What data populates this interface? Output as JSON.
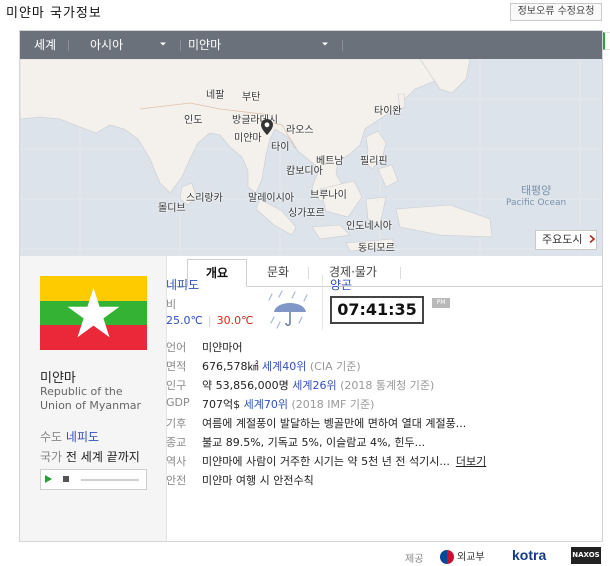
{
  "page": {
    "title": "미얀마 국가정보",
    "report_button": "정보오류 수정요청"
  },
  "nav": {
    "world": "세계",
    "region": "아시아",
    "country": "미얀마"
  },
  "map": {
    "cities": {
      "nepal": "네팔",
      "bhutan": "부탄",
      "india": "인도",
      "bangladesh": "방글라데시",
      "myanmar": "미얀마",
      "laos": "라오스",
      "thailand": "타이",
      "vietnam": "베트남",
      "cambodia": "캄보디아",
      "philippines": "필리핀",
      "taiwan": "타이완",
      "srilanka": "스리랑카",
      "maldives": "몰디브",
      "malaysia": "말레이시아",
      "brunei": "브루나이",
      "singapore": "싱가포르",
      "indonesia": "인도네시아",
      "timor": "동티모르"
    },
    "ocean_ko": "태평양",
    "ocean_en": "Pacific Ocean",
    "major_cities_button": "주요도시"
  },
  "profile": {
    "name_ko": "미얀마",
    "name_en": "Republic of the Union of Myanmar",
    "capital_label": "수도",
    "capital": "네피도",
    "anthem_label": "국가",
    "anthem": "전 세계 끝까지"
  },
  "tabs": [
    {
      "label": "개요",
      "active": true
    },
    {
      "label": "문화",
      "active": false
    },
    {
      "label": "경제·물가",
      "active": false
    }
  ],
  "capital_weather": {
    "city": "네피도",
    "condition": "비",
    "low": "25.0℃",
    "high": "30.0℃"
  },
  "city_clock": {
    "city": "양곤",
    "time": "07:41:35",
    "ampm": "PM"
  },
  "info": {
    "language": {
      "label": "언어",
      "value": "미얀마어"
    },
    "area": {
      "label": "면적",
      "value": "676,578㎢",
      "rank": "세계40위",
      "source": "(CIA 기준)"
    },
    "population": {
      "label": "인구",
      "value": "약 53,856,000명",
      "rank": "세계26위",
      "source": "(2018 통계청 기준)"
    },
    "gdp": {
      "label": "GDP",
      "value": "707억$",
      "rank": "세계70위",
      "source": "(2018 IMF 기준)"
    },
    "climate": {
      "label": "기후",
      "value": "여름에 계절풍이 발달하는 벵골만에 면하여 열대 계절풍..."
    },
    "religion": {
      "label": "종교",
      "value": "불교 89.5%, 기독교 5%, 이슬람교 4%, 힌두..."
    },
    "history": {
      "label": "역사",
      "value": "미얀마에 사람이 거주한 시기는 약 5천 년 전 석기시...",
      "more": "더보기"
    },
    "safety": {
      "label": "안전",
      "value": "미얀마 여행 시 안전수칙"
    }
  },
  "footer": {
    "label": "제공",
    "mofa": "외교부",
    "kotra": "kotra",
    "naxos": "NAXOS"
  },
  "colors": {
    "nav_bg": "#6b717b",
    "link_blue": "#2f50b8",
    "temp_high": "#d2281e",
    "map_land": "#f4f1ec",
    "map_sea": "#dde3ea"
  }
}
